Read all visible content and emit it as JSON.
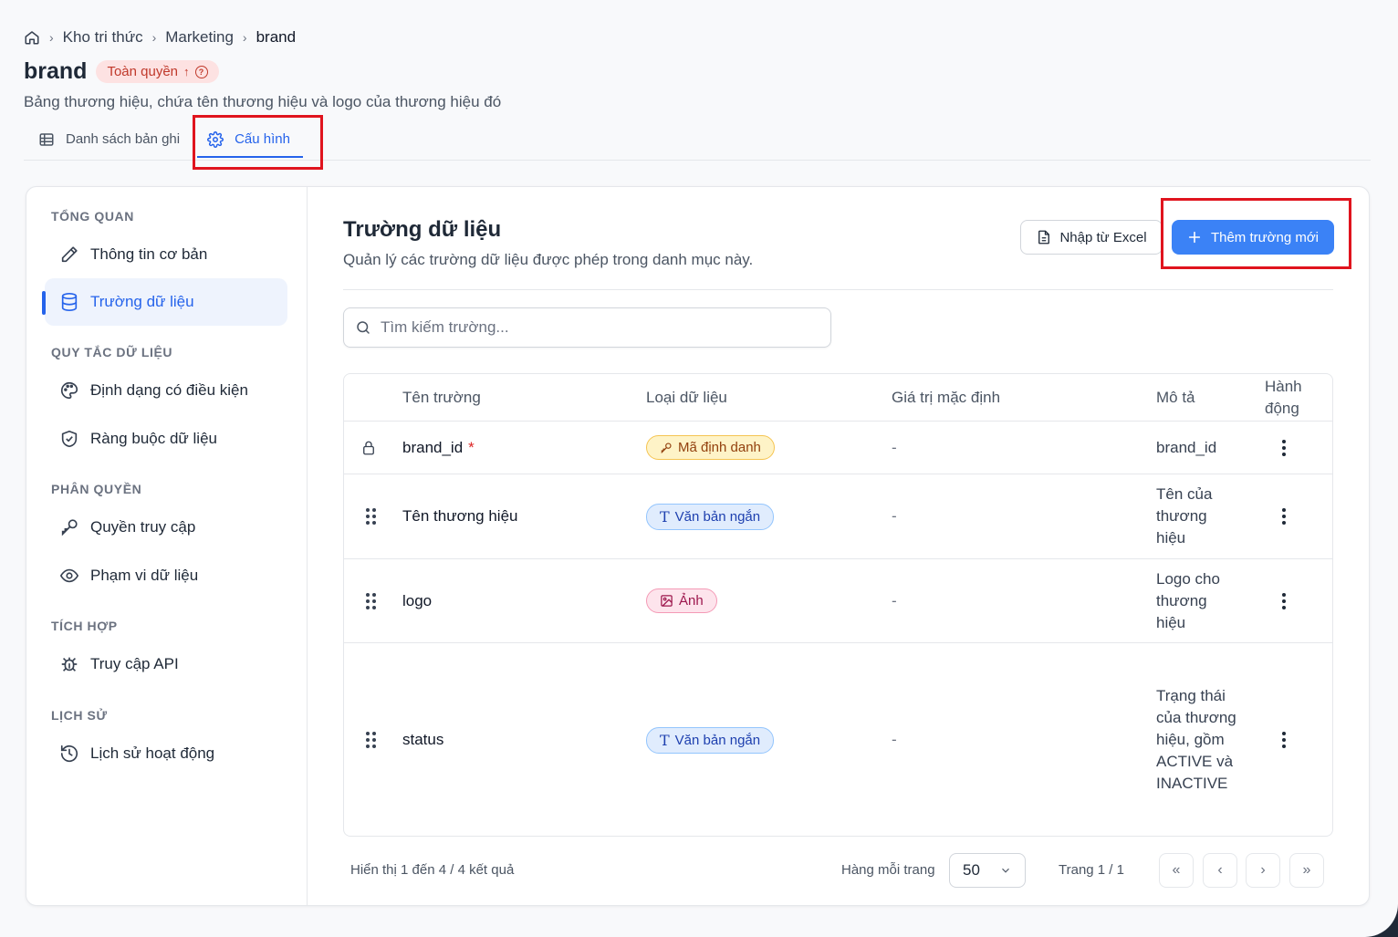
{
  "breadcrumb": {
    "items": [
      "Kho tri thức",
      "Marketing",
      "brand"
    ]
  },
  "header": {
    "title": "brand",
    "permission_badge": "Toàn quyền",
    "description": "Bảng thương hiệu, chứa tên thương hiệu và logo của thương hiệu đó"
  },
  "tabs": [
    {
      "label": "Danh sách bản ghi",
      "icon": "table-icon",
      "active": false
    },
    {
      "label": "Cấu hình",
      "icon": "gear-icon",
      "active": true
    }
  ],
  "sidebar": {
    "sections": [
      {
        "title": "TỔNG QUAN",
        "items": [
          {
            "label": "Thông tin cơ bản",
            "icon": "pencil-icon"
          },
          {
            "label": "Trường dữ liệu",
            "icon": "database-icon",
            "active": true
          }
        ]
      },
      {
        "title": "QUY TẮC DỮ LIỆU",
        "items": [
          {
            "label": "Định dạng có điều kiện",
            "icon": "palette-icon"
          },
          {
            "label": "Ràng buộc dữ liệu",
            "icon": "shield-check-icon"
          }
        ]
      },
      {
        "title": "PHÂN QUYỀN",
        "items": [
          {
            "label": "Quyền truy cập",
            "icon": "key-icon"
          },
          {
            "label": "Phạm vi dữ liệu",
            "icon": "eye-icon"
          }
        ]
      },
      {
        "title": "TÍCH HỢP",
        "items": [
          {
            "label": "Truy cập API",
            "icon": "api-icon"
          }
        ]
      },
      {
        "title": "LỊCH SỬ",
        "items": [
          {
            "label": "Lịch sử hoạt động",
            "icon": "history-icon"
          }
        ]
      }
    ]
  },
  "main": {
    "title": "Trường dữ liệu",
    "description": "Quản lý các trường dữ liệu được phép trong danh mục này.",
    "import_button": "Nhập từ Excel",
    "add_button": "Thêm trường mới",
    "search_placeholder": "Tìm kiếm trường...",
    "table": {
      "headers": [
        "Tên trường",
        "Loại dữ liệu",
        "Giá trị mặc định",
        "Mô tả",
        "Hành động"
      ],
      "rows": [
        {
          "name": "brand_id",
          "required": true,
          "locked": true,
          "type": "Mã định danh",
          "type_kind": "key",
          "default": "-",
          "description": "brand_id"
        },
        {
          "name": "Tên thương hiệu",
          "required": false,
          "locked": false,
          "type": "Văn bản ngắn",
          "type_kind": "text",
          "default": "-",
          "description": "Tên của thương hiệu"
        },
        {
          "name": "logo",
          "required": false,
          "locked": false,
          "type": "Ảnh",
          "type_kind": "image",
          "default": "-",
          "description": "Logo cho thương hiệu"
        },
        {
          "name": "status",
          "required": false,
          "locked": false,
          "type": "Văn bản ngắn",
          "type_kind": "text",
          "default": "-",
          "description": "Trạng thái của thương hiệu, gồm ACTIVE và INACTIVE"
        }
      ]
    },
    "footer": {
      "summary": "Hiển thị 1 đến 4 / 4 kết quả",
      "rows_per_page_label": "Hàng mỗi trang",
      "rows_per_page_value": "50",
      "page_label": "Trang 1 / 1"
    }
  },
  "colors": {
    "accent": "#3b82f6",
    "highlight_box": "#e0141e",
    "required": "#dc2626"
  }
}
